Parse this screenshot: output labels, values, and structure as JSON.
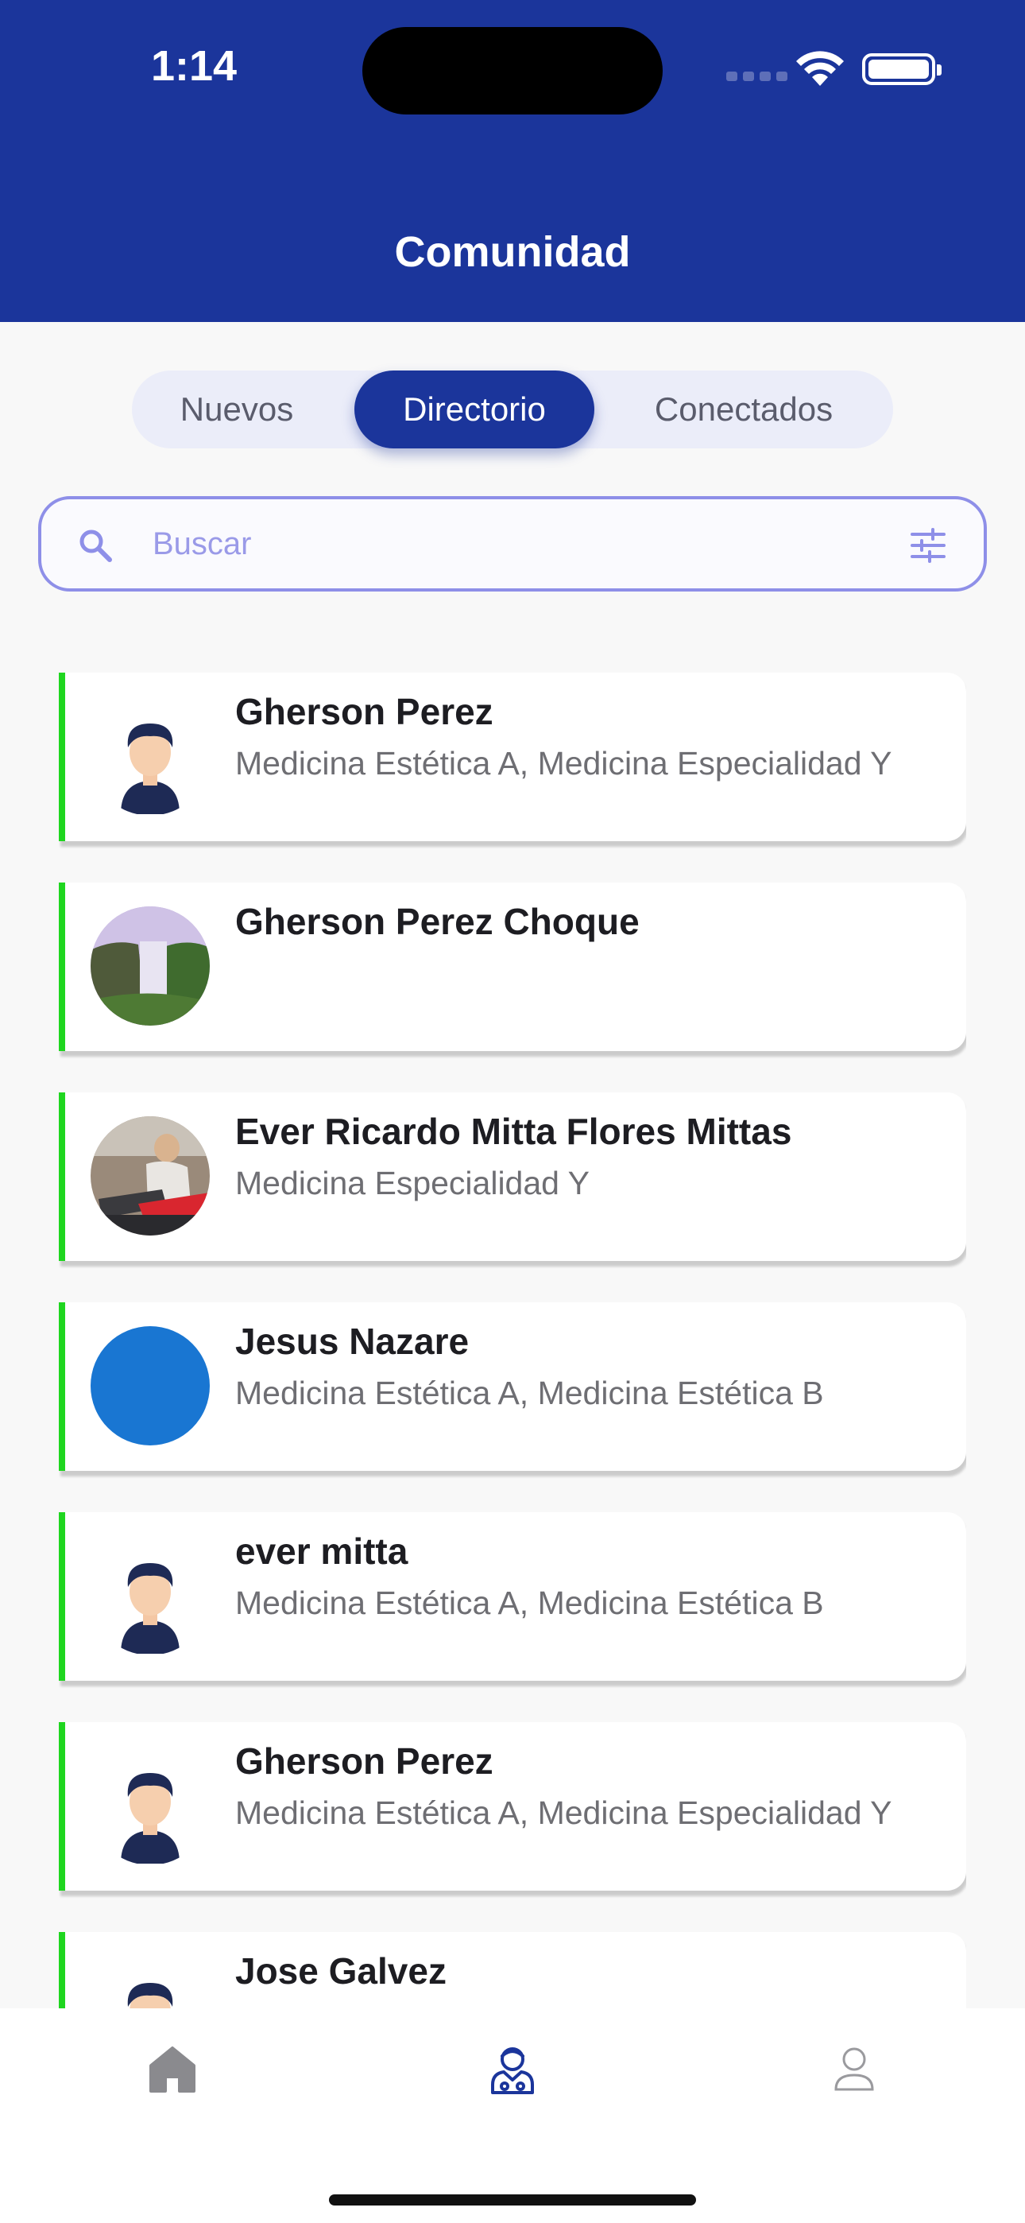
{
  "status_bar": {
    "time": "1:14"
  },
  "header": {
    "title": "Comunidad"
  },
  "tabs": [
    {
      "label": "Nuevos",
      "active": false
    },
    {
      "label": "Directorio",
      "active": true
    },
    {
      "label": "Conectados",
      "active": false
    }
  ],
  "search": {
    "placeholder": "Buscar",
    "value": ""
  },
  "members": [
    {
      "name": "Gherson Perez",
      "specialties": "Medicina Estética A, Medicina Especialidad Y",
      "avatar": "default-male-avatar"
    },
    {
      "name": "Gherson Perez Choque",
      "specialties": "",
      "avatar": "waterfall-photo"
    },
    {
      "name": "Ever Ricardo Mitta Flores Mittas",
      "specialties": "Medicina Especialidad Y",
      "avatar": "person-photo"
    },
    {
      "name": "Jesus Nazare",
      "specialties": "Medicina Estética A, Medicina Estética B",
      "avatar": "blue-circle"
    },
    {
      "name": "ever mitta",
      "specialties": "Medicina Estética A, Medicina Estética B",
      "avatar": "default-male-avatar"
    },
    {
      "name": "Gherson Perez",
      "specialties": "Medicina Estética A, Medicina Especialidad Y",
      "avatar": "default-male-avatar"
    },
    {
      "name": "Jose Galvez",
      "specialties": "",
      "avatar": "default-male-avatar"
    }
  ],
  "bottom_nav": [
    {
      "icon": "home-icon",
      "active": false
    },
    {
      "icon": "doctor-community-icon",
      "active": true
    },
    {
      "icon": "profile-icon",
      "active": false
    }
  ],
  "colors": {
    "primary": "#1b359b",
    "accent_green": "#1fd61f",
    "search_border": "#8e8fe8",
    "avatar_blue": "#1976d2"
  }
}
